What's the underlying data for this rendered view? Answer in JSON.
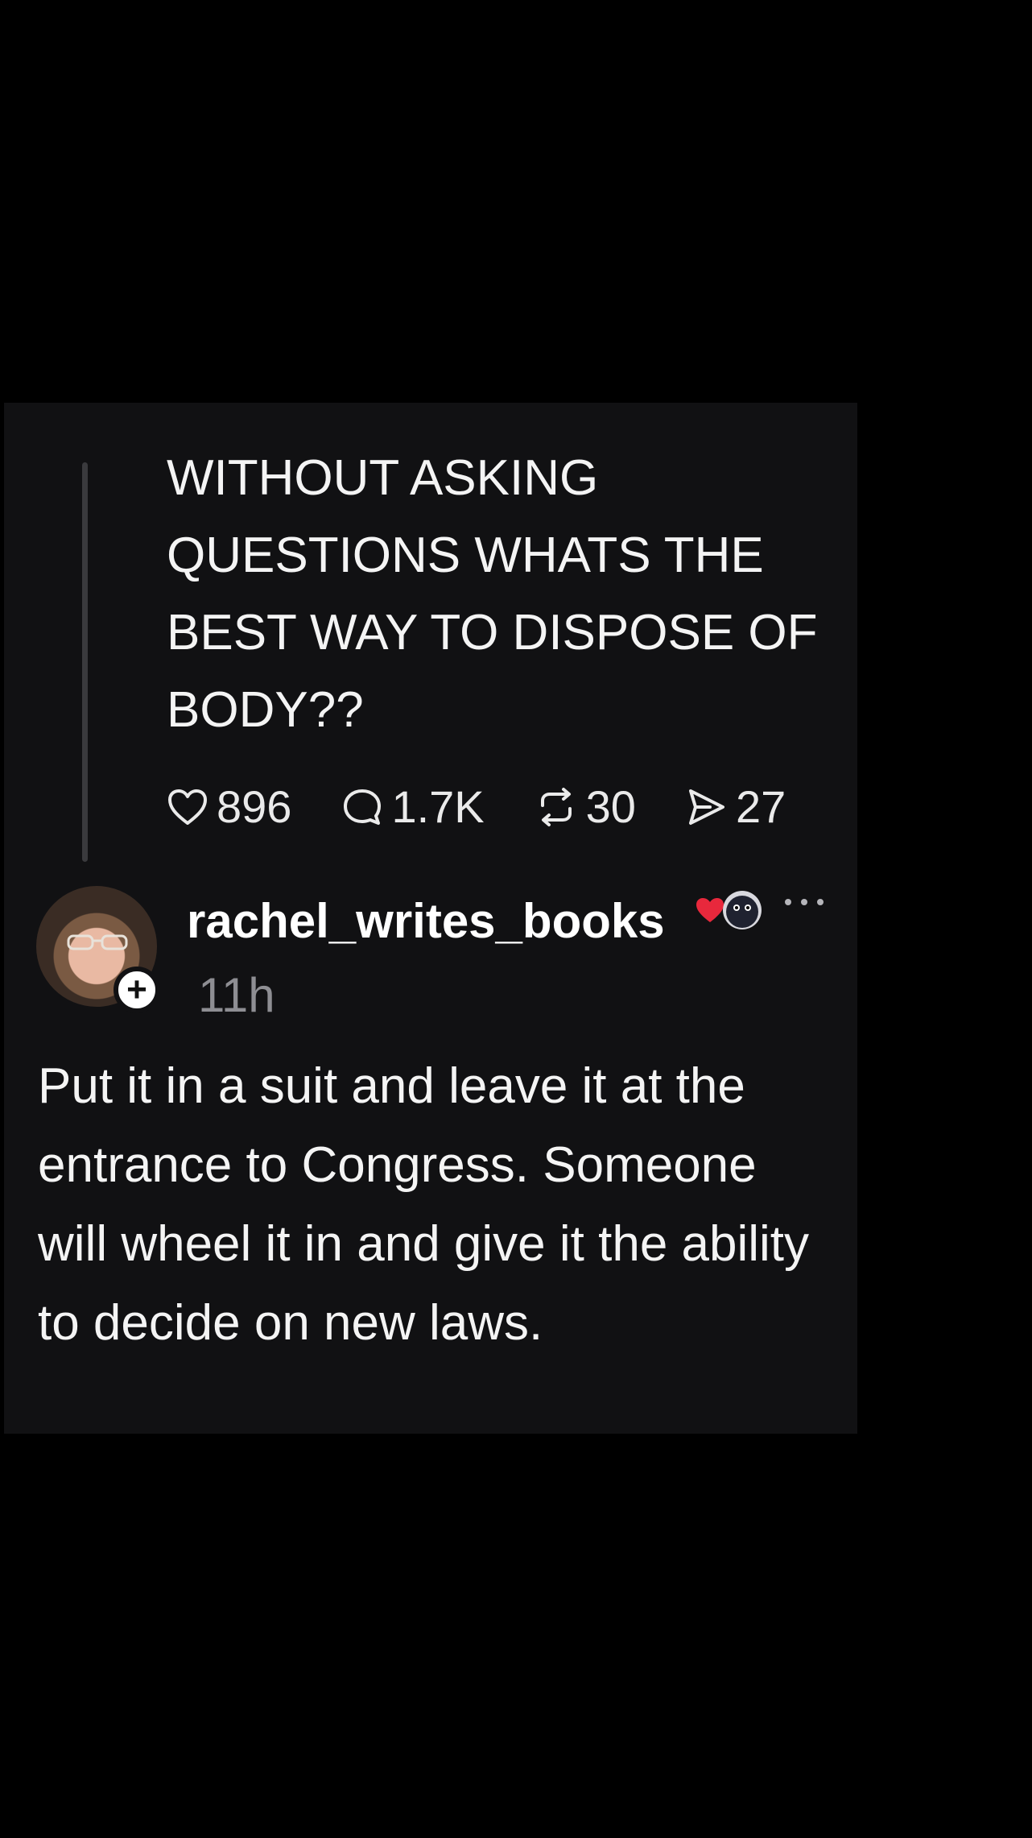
{
  "parent_post": {
    "text": "WITHOUT ASKING QUESTIONS WHATS THE BEST WAY TO DISPOSE OF BODY??",
    "likes": "896",
    "replies": "1.7K",
    "reposts": "30",
    "shares": "27"
  },
  "reply": {
    "username": "rachel_writes_books",
    "time": "11h",
    "badge_emojis": [
      "heart-icon",
      "pet-icon"
    ],
    "text": "Put it in a suit and leave it at the entrance to Congress. Someone will wheel it in and give it the ability to decide on new laws."
  },
  "icons": {
    "like": "heart-outline-icon",
    "reply": "comment-bubble-icon",
    "repost": "repost-arrows-icon",
    "share": "send-icon",
    "more": "more-dots-icon",
    "follow": "plus-icon"
  },
  "colors": {
    "background": "#000000",
    "card": "#111113",
    "text": "#f4f4f4",
    "muted": "#8e8e93",
    "heart": "#e8283c"
  }
}
